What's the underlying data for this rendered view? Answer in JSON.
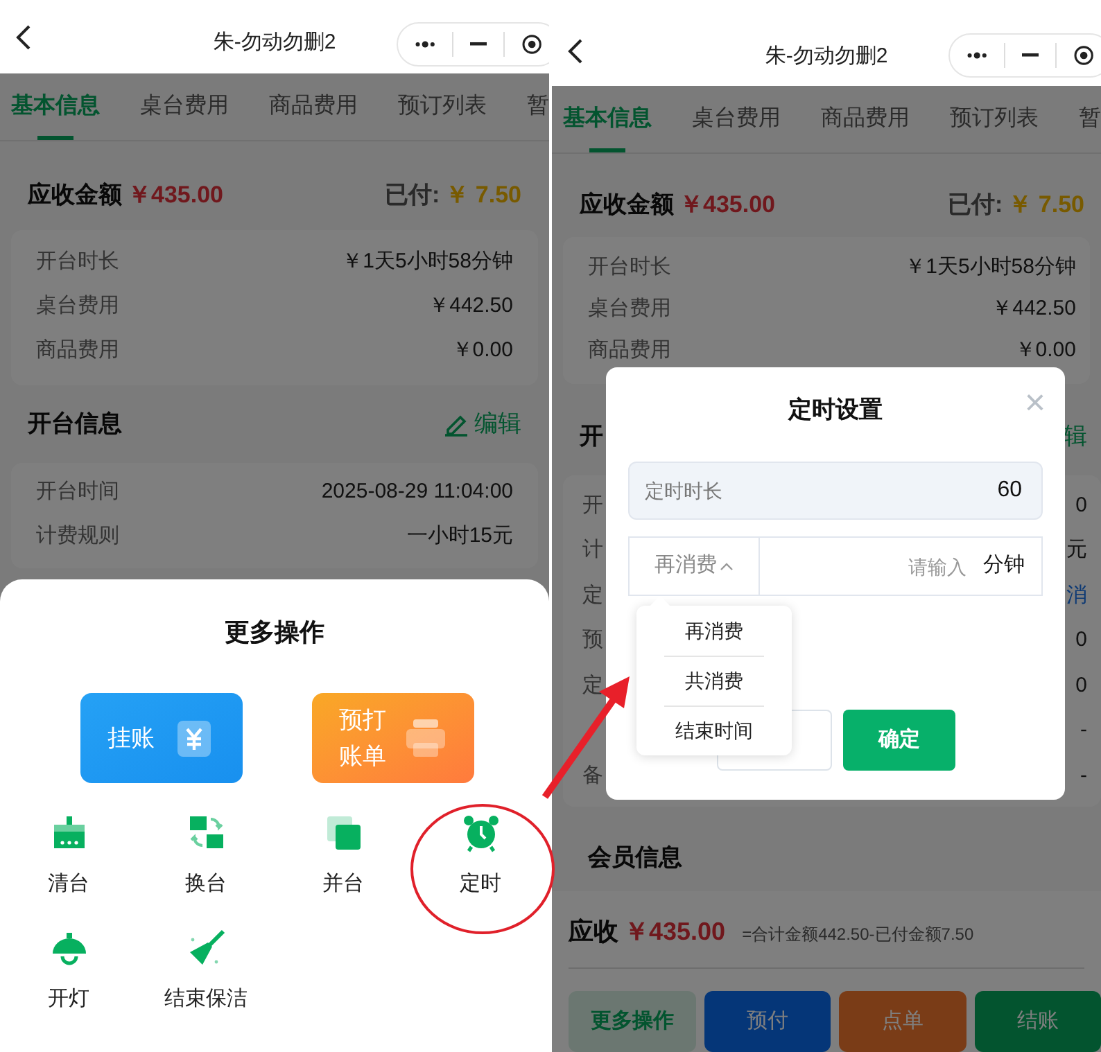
{
  "screens": [
    {
      "title": "朱-勿动勿删2",
      "tabs": [
        {
          "label": "基本信息",
          "selected": true
        },
        {
          "label": "桌台费用",
          "selected": false
        },
        {
          "label": "商品费用",
          "selected": false
        },
        {
          "label": "预订列表",
          "selected": false
        },
        {
          "label": "暂",
          "selected": false
        }
      ],
      "due_label": "应收金额",
      "due_amount": "￥435.00",
      "paid_label": "已付:",
      "paid_amount": "￥ 7.50",
      "fee_rows": [
        {
          "label": "开台时长",
          "value": "￥1天5小时58分钟"
        },
        {
          "label": "桌台费用",
          "value": "￥442.50"
        },
        {
          "label": "商品费用",
          "value": "￥0.00"
        }
      ],
      "section_title": "开台信息",
      "edit_label": "编辑",
      "info_rows": [
        {
          "label": "开台时间",
          "value": "2025-08-29 11:04:00",
          "kind": "text"
        },
        {
          "label": "计费规则",
          "value": "一小时15元",
          "kind": "text"
        }
      ],
      "sheet": {
        "title": "更多操作",
        "big_buttons": [
          {
            "label": "挂账",
            "kind": "credit"
          },
          {
            "label": "预打账单",
            "kind": "print"
          }
        ],
        "actions": [
          {
            "label": "清台",
            "kind": "sweep"
          },
          {
            "label": "换台",
            "kind": "swap"
          },
          {
            "label": "并台",
            "kind": "merge"
          },
          {
            "label": "定时",
            "kind": "alarm"
          },
          {
            "label": "开灯",
            "kind": "lamp"
          },
          {
            "label": "结束保洁",
            "kind": "broom"
          }
        ]
      }
    },
    {
      "title": "朱-勿动勿删2",
      "tabs": [
        {
          "label": "基本信息",
          "selected": true
        },
        {
          "label": "桌台费用",
          "selected": false
        },
        {
          "label": "商品费用",
          "selected": false
        },
        {
          "label": "预订列表",
          "selected": false
        },
        {
          "label": "暂",
          "selected": false
        }
      ],
      "due_label": "应收金额",
      "due_amount": "￥435.00",
      "paid_label": "已付:",
      "paid_amount": "￥ 7.50",
      "fee_rows": [
        {
          "label": "开台时长",
          "value": "￥1天5小时58分钟"
        },
        {
          "label": "桌台费用",
          "value": "￥442.50"
        },
        {
          "label": "商品费用",
          "value": "￥0.00"
        }
      ],
      "section_title": "开",
      "edit_label": "辑",
      "info_rows": [
        {
          "label": "开",
          "value": "0",
          "kind": "text"
        },
        {
          "label": "计",
          "value": "元",
          "kind": "text"
        },
        {
          "label": "定",
          "value": "消",
          "kind": "link"
        },
        {
          "label": "预",
          "value": "0",
          "kind": "text"
        },
        {
          "label": "定",
          "value": "0",
          "kind": "text"
        },
        {
          "value": "-",
          "kind": "text"
        },
        {
          "label": "备",
          "value": "-",
          "kind": "text"
        }
      ],
      "member_title": "会员信息",
      "footer": {
        "label": "应收",
        "amount": "￥435.00",
        "formula": "=合计金额442.50-已付金额7.50",
        "buttons": [
          {
            "label": "更多操作",
            "kind": "more"
          },
          {
            "label": "预付",
            "kind": "prepay"
          },
          {
            "label": "点单",
            "kind": "order"
          },
          {
            "label": "结账",
            "kind": "checkout"
          }
        ]
      },
      "dialog": {
        "title": "定时设置",
        "close": "×",
        "duration_label": "定时时长",
        "duration_value": "60",
        "mode_value": "再消费",
        "mode_expanded": true,
        "input_placeholder": "请输入",
        "unit": "分钟",
        "options": [
          {
            "label": "再消费"
          },
          {
            "label": "共消费"
          },
          {
            "label": "结束时间"
          }
        ],
        "confirm": "确定"
      }
    }
  ]
}
